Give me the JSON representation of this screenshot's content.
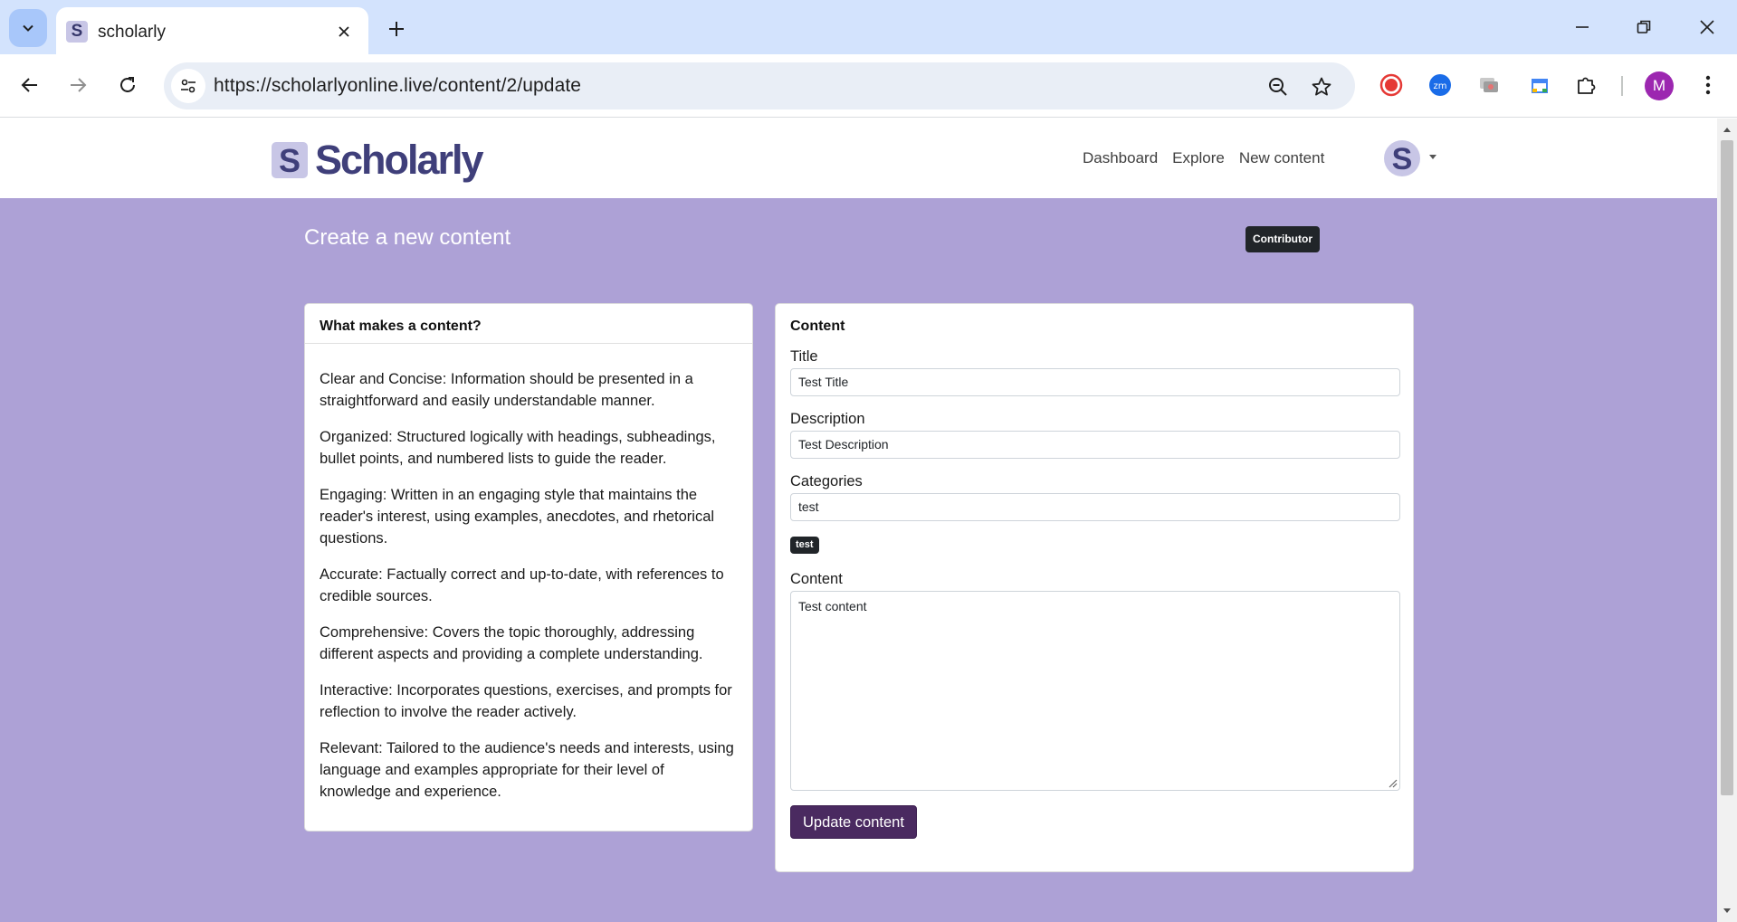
{
  "browser": {
    "tab_title": "scholarly",
    "tab_favicon": "S",
    "url": "https://scholarlyonline.live/content/2/update",
    "profile_initial": "M"
  },
  "site": {
    "brand_initial": "S",
    "brand_name": "Scholarly",
    "avatar_initial": "S",
    "nav": [
      "Dashboard",
      "Explore",
      "New content"
    ]
  },
  "page": {
    "title": "Create a new content",
    "role_badge": "Contributor"
  },
  "guide": {
    "header": "What makes a content?",
    "items": [
      "Clear and Concise: Information should be presented in a straightforward and easily understandable manner.",
      "Organized: Structured logically with headings, subheadings, bullet points, and numbered lists to guide the reader.",
      "Engaging: Written in an engaging style that maintains the reader's interest, using examples, anecdotes, and rhetorical questions.",
      "Accurate: Factually correct and up-to-date, with references to credible sources.",
      "Comprehensive: Covers the topic thoroughly, addressing different aspects and providing a complete understanding.",
      "Interactive: Incorporates questions, exercises, and prompts for reflection to involve the reader actively.",
      "Relevant: Tailored to the audience's needs and interests, using language and examples appropriate for their level of knowledge and experience."
    ]
  },
  "form": {
    "header": "Content",
    "title_label": "Title",
    "title_value": "Test Title",
    "description_label": "Description",
    "description_value": "Test Description",
    "categories_label": "Categories",
    "categories_value": "test",
    "category_tag": "test",
    "content_label": "Content",
    "content_value": "Test content",
    "submit_label": "Update content"
  },
  "colors": {
    "page_background": "#ada1d6",
    "brand": "#3f3f7a",
    "primary_button": "#4a2a60"
  }
}
